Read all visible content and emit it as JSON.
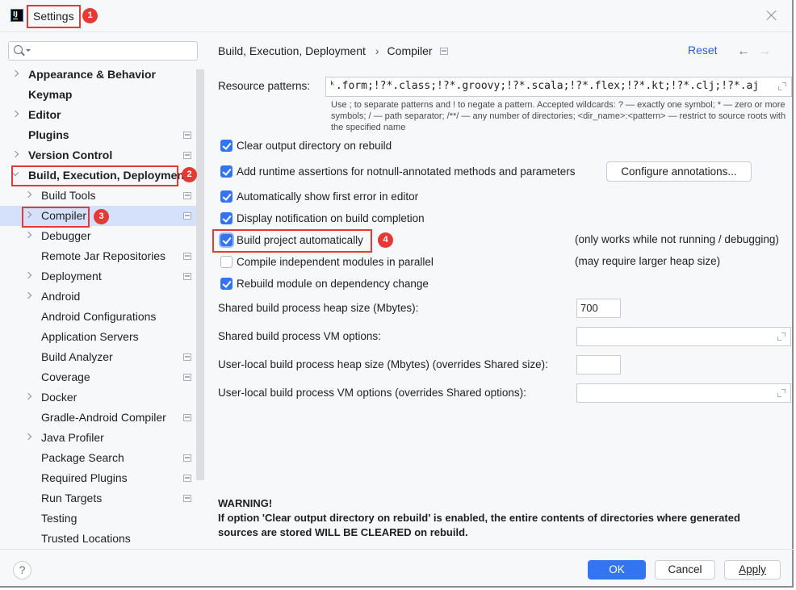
{
  "window": {
    "title": "Settings",
    "app_icon": "intellij-logo-icon",
    "close_icon": "close-icon"
  },
  "annotations": [
    "1",
    "2",
    "3",
    "4"
  ],
  "search": {
    "value": "",
    "placeholder": ""
  },
  "sidebar": {
    "items": [
      {
        "label": "Appearance & Behavior",
        "level": 0,
        "expandable": true,
        "expanded": false,
        "project_icon": false
      },
      {
        "label": "Keymap",
        "level": 0,
        "expandable": false,
        "project_icon": false
      },
      {
        "label": "Editor",
        "level": 0,
        "expandable": true,
        "expanded": false,
        "project_icon": false
      },
      {
        "label": "Plugins",
        "level": 0,
        "expandable": false,
        "project_icon": true
      },
      {
        "label": "Version Control",
        "level": 0,
        "expandable": true,
        "expanded": false,
        "project_icon": true
      },
      {
        "label": "Build, Execution, Deployment",
        "level": 0,
        "expandable": true,
        "expanded": true,
        "project_icon": false
      },
      {
        "label": "Build Tools",
        "level": 1,
        "expandable": true,
        "expanded": false,
        "project_icon": true
      },
      {
        "label": "Compiler",
        "level": 1,
        "expandable": true,
        "expanded": false,
        "project_icon": true,
        "selected": true
      },
      {
        "label": "Debugger",
        "level": 1,
        "expandable": true,
        "expanded": false,
        "project_icon": false
      },
      {
        "label": "Remote Jar Repositories",
        "level": 1,
        "expandable": false,
        "project_icon": true
      },
      {
        "label": "Deployment",
        "level": 1,
        "expandable": true,
        "expanded": false,
        "project_icon": true
      },
      {
        "label": "Android",
        "level": 1,
        "expandable": true,
        "expanded": false,
        "project_icon": false
      },
      {
        "label": "Android Configurations",
        "level": 1,
        "expandable": false,
        "project_icon": false
      },
      {
        "label": "Application Servers",
        "level": 1,
        "expandable": false,
        "project_icon": false
      },
      {
        "label": "Build Analyzer",
        "level": 1,
        "expandable": false,
        "project_icon": true
      },
      {
        "label": "Coverage",
        "level": 1,
        "expandable": false,
        "project_icon": true
      },
      {
        "label": "Docker",
        "level": 1,
        "expandable": true,
        "expanded": false,
        "project_icon": false
      },
      {
        "label": "Gradle-Android Compiler",
        "level": 1,
        "expandable": false,
        "project_icon": true
      },
      {
        "label": "Java Profiler",
        "level": 1,
        "expandable": true,
        "expanded": false,
        "project_icon": false
      },
      {
        "label": "Package Search",
        "level": 1,
        "expandable": false,
        "project_icon": true
      },
      {
        "label": "Required Plugins",
        "level": 1,
        "expandable": false,
        "project_icon": true
      },
      {
        "label": "Run Targets",
        "level": 1,
        "expandable": false,
        "project_icon": true
      },
      {
        "label": "Testing",
        "level": 1,
        "expandable": false,
        "project_icon": false
      },
      {
        "label": "Trusted Locations",
        "level": 1,
        "expandable": false,
        "project_icon": false
      }
    ]
  },
  "header": {
    "breadcrumb": [
      "Build, Execution, Deployment",
      "Compiler"
    ],
    "breadcrumb_separator": "›",
    "reset_label": "Reset",
    "back_arrow": "←",
    "forward_arrow": "→"
  },
  "compiler": {
    "resource_patterns_label": "Resource patterns:",
    "resource_patterns_value": "ᵏ.form;!?*.class;!?*.groovy;!?*.scala;!?*.flex;!?*.kt;!?*.clj;!?*.aj",
    "resource_patterns_hint": "Use ; to separate patterns and ! to negate a pattern. Accepted wildcards: ? — exactly one symbol; * — zero or more symbols; / — path separator; /**/ — any number of directories; <dir_name>:<pattern> — restrict to source roots with the specified name",
    "options": [
      {
        "label": "Clear output directory on rebuild",
        "checked": true
      },
      {
        "label": "Add runtime assertions for notnull-annotated methods and parameters",
        "checked": true
      },
      {
        "label": "Automatically show first error in editor",
        "checked": true
      },
      {
        "label": "Display notification on build completion",
        "checked": true
      },
      {
        "label": "Build project automatically",
        "checked": true,
        "note": "(only works while not running / debugging)"
      },
      {
        "label": "Compile independent modules in parallel",
        "checked": false,
        "note": "(may require larger heap size)"
      },
      {
        "label": "Rebuild module on dependency change",
        "checked": true
      }
    ],
    "configure_annotations_label": "Configure annotations...",
    "shared_heap_label": "Shared build process heap size (Mbytes):",
    "shared_heap_value": "700",
    "shared_vm_label": "Shared build process VM options:",
    "shared_vm_value": "",
    "user_heap_label": "User-local build process heap size (Mbytes) (overrides Shared size):",
    "user_heap_value": "",
    "user_vm_label": "User-local build process VM options (overrides Shared options):",
    "user_vm_value": "",
    "warning_title": "WARNING!",
    "warning_text": "If option 'Clear output directory on rebuild' is enabled, the entire contents of directories where generated sources are stored WILL BE CLEARED on rebuild."
  },
  "footer": {
    "help_label": "?",
    "ok_label": "OK",
    "cancel_label": "Cancel",
    "apply_label": "Apply"
  },
  "colors": {
    "accent": "#3574f0",
    "selection": "#d5e1fb",
    "annotation_red": "#e53935",
    "link": "#2f5cd0",
    "background": "#f7f8fa"
  }
}
